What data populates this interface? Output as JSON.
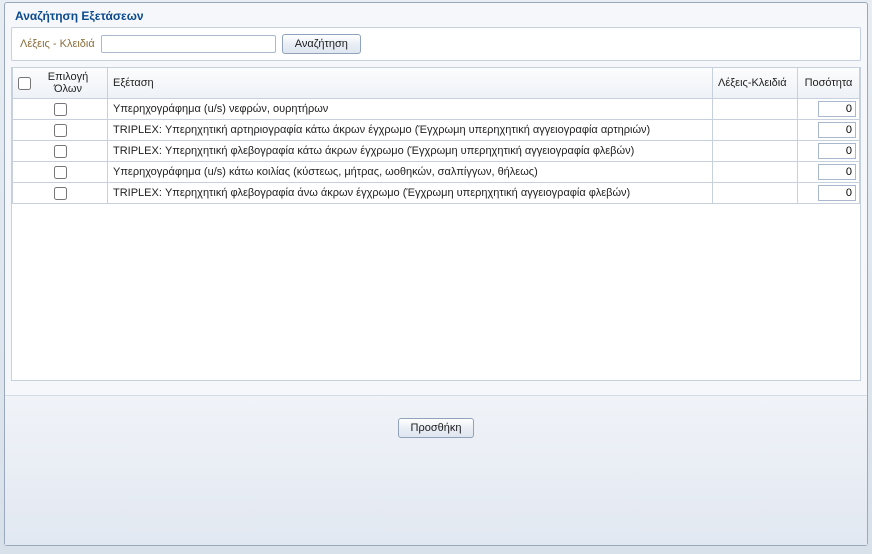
{
  "dialog": {
    "title": "Αναζήτηση Εξετάσεων"
  },
  "search": {
    "label": "Λέξεις - Κλειδιά",
    "value": "",
    "button": "Αναζήτηση"
  },
  "grid": {
    "headers": {
      "selectAll": "Επιλογή Όλων",
      "exam": "Εξέταση",
      "keywords": "Λέξεις-Κλειδιά",
      "qty": "Ποσότητα"
    },
    "rows": [
      {
        "checked": false,
        "exam": "Υπερηχογράφημα (u/s) νεφρών, ουρητήρων",
        "keywords": "",
        "qty": "0"
      },
      {
        "checked": false,
        "exam": "TRIPLEX: Υπερηχητική αρτηριογραφία κάτω άκρων έγχρωμο (Έγχρωμη υπερηχητική αγγειογραφία αρτηριών)",
        "keywords": "",
        "qty": "0"
      },
      {
        "checked": false,
        "exam": "TRIPLEX: Υπερηχητική φλεβογραφία κάτω άκρων έγχρωμο (Έγχρωμη υπερηχητική αγγειογραφία φλεβών)",
        "keywords": "",
        "qty": "0"
      },
      {
        "checked": false,
        "exam": "Υπερηχογράφημα (u/s) κάτω κοιλίας (κύστεως, μήτρας, ωοθηκών, σαλπίγγων, θήλεως)",
        "keywords": "",
        "qty": "0"
      },
      {
        "checked": false,
        "exam": "TRIPLEX: Υπερηχητική φλεβογραφία άνω άκρων έγχρωμο (Έγχρωμη υπερηχητική αγγειογραφία φλεβών)",
        "keywords": "",
        "qty": "0"
      }
    ]
  },
  "footer": {
    "addButton": "Προσθήκη"
  }
}
